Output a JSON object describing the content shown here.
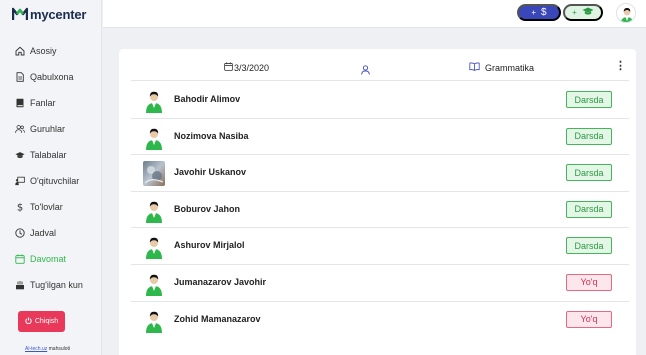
{
  "brand": {
    "name": "mycenter",
    "logo_icon": "mycenter-logo-icon"
  },
  "sidebar": {
    "items": [
      {
        "label": "Asosiy",
        "icon": "home-icon"
      },
      {
        "label": "Qabulxona",
        "icon": "document-icon"
      },
      {
        "label": "Fanlar",
        "icon": "book-icon"
      },
      {
        "label": "Guruhlar",
        "icon": "users-icon"
      },
      {
        "label": "Talabalar",
        "icon": "graduation-cap-icon"
      },
      {
        "label": "O'qituvchilar",
        "icon": "chalkboard-icon"
      },
      {
        "label": "To'lovlar",
        "icon": "dollar-icon"
      },
      {
        "label": "Jadval",
        "icon": "clock-icon"
      },
      {
        "label": "Davomat",
        "icon": "calendar-icon",
        "active": true
      },
      {
        "label": "Tug'ilgan kun",
        "icon": "birthday-cake-icon"
      }
    ],
    "logout_label": "Chiqish",
    "footer_link": "Al-tech.uz",
    "footer_text": "mahsuloti"
  },
  "topbar": {
    "pay_button": {
      "plus": "+",
      "symbol": "$"
    },
    "student_button": {
      "plus": "+",
      "icon": "graduation-cap-icon"
    }
  },
  "attendance": {
    "date": "3/3/2020",
    "subject": "Grammatika",
    "more": "⋮",
    "students": [
      {
        "name": "Bahodir Alimov",
        "status": "Darsda",
        "present": true,
        "avatar": "default"
      },
      {
        "name": "Nozimova Nasiba",
        "status": "Darsda",
        "present": true,
        "avatar": "default"
      },
      {
        "name": "Javohir Uskanov",
        "status": "Darsda",
        "present": true,
        "avatar": "photo"
      },
      {
        "name": "Boburov Jahon",
        "status": "Darsda",
        "present": true,
        "avatar": "default"
      },
      {
        "name": "Ashurov Mirjalol",
        "status": "Darsda",
        "present": true,
        "avatar": "default"
      },
      {
        "name": "Jumanazarov Javohir",
        "status": "Yo'q",
        "present": false,
        "avatar": "default"
      },
      {
        "name": "Zohid Mamanazarov",
        "status": "Yo'q",
        "present": false,
        "avatar": "default"
      }
    ]
  },
  "colors": {
    "accent_green": "#2eb84b",
    "primary_blue": "#3a47b8",
    "danger": "#e8395a"
  }
}
